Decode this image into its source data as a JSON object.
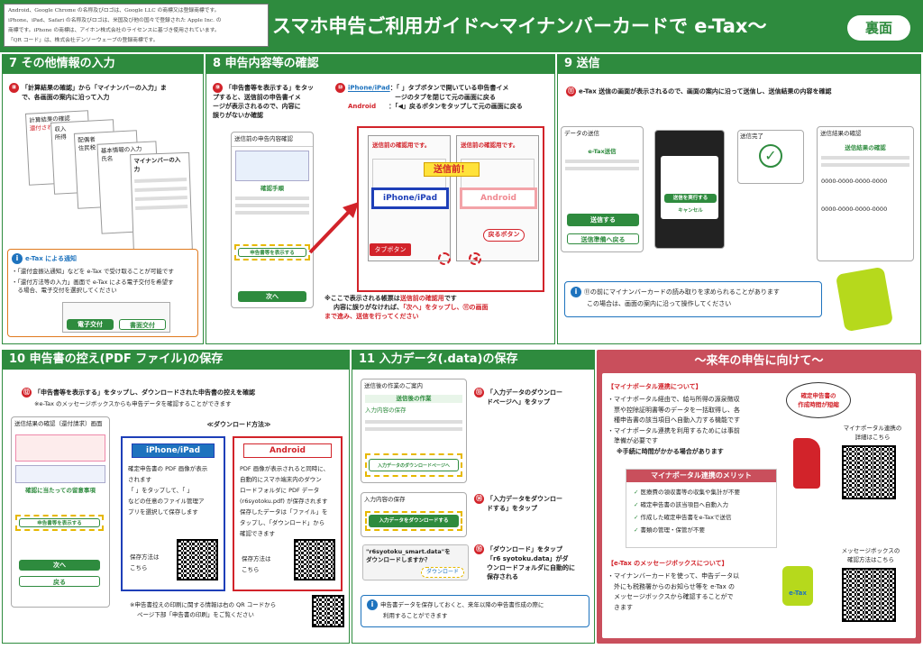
{
  "header": {
    "notice": [
      "Android、Google Chrome の名称及びロゴは、Google LLC の商標又は登録商標です。",
      "iPhone、iPad、Safari の名称及びロゴは、米国及び他の国々で登録された Apple Inc. の",
      "商標です。iPhone の商標は、アイホン株式会社のライセンスに基づき使用されています。",
      "「QR コード」は、株式会社デンソーウェーブの登録商標です。"
    ],
    "title": "スマホ申告ご利用ガイド～マイナンバーカードで e-Tax～",
    "badge": "裏面"
  },
  "s7": {
    "title": "7 その他情報の入力",
    "step": "⑧",
    "text1": "「計算結果の確認」から「マイナンバーの入力」ま",
    "text2": "で、各画面の案内に沿って入力",
    "screen_labels": [
      "計算結果の確認",
      "還付される金額",
      "収入",
      "所得",
      "配偶者",
      "住民税",
      "基本情報の入力",
      "氏名",
      "マイナンバーの入力"
    ],
    "info_title": "e-Tax による通知",
    "info1": "・「還付金振込通知」などを e-Tax で受け取ることが可能です",
    "info2": "・「還付方法等の入力」画面で e-Tax による電子交付を希望す",
    "info3": "　る場合、電子交付を選択してください",
    "mini_btn1": "電子交付",
    "mini_btn2": "書面交付"
  },
  "s8": {
    "title": "8 申告内容等の確認",
    "step9": "⑨",
    "t1": "「申告書等を表示する」をタッ",
    "t2": "プすると、送信前の申告書イメ",
    "t3": "ージが表示されるので、内容に",
    "t4": "誤りがないか確認",
    "step10": "⑩",
    "ios_label": "iPhone/iPad",
    "ios_text1": "：「 」タブボタンで開いている申告書イメ",
    "ios_text2": "ージのタブを閉じて元の画面に戻る",
    "android_label": "Android",
    "android_text": "：「◀」戻るボタンをタップして元の画面に戻る",
    "phone_title": "送信前の申告内容確認",
    "phone_section": "確認手順",
    "phone_btn": "申告書等を表示する",
    "phone_next": "次へ",
    "preview_banner": "送信前！",
    "preview_ios": "iPhone/iPad",
    "preview_android": "Android",
    "preview_stamp": "送信前の確認用です。",
    "tab_btn": "タブボタン",
    "back_btn": "戻るボタン",
    "note1": "※ここで表示される帳票は",
    "note1_red": "送信前の確認用",
    "note1_end": "です",
    "note2": "内容に誤りがなければ、",
    "note2_red": "「次へ」をタップし、⑪の画面",
    "note3_red": "まで進み、送信を行ってください"
  },
  "s9": {
    "title": "9 送信",
    "step": "⑪",
    "text": "e-Tax 送信の画面が表示されるので、画面の案内に沿って送信し、送信結果の内容を確認",
    "screen1_title": "データの送信",
    "screen1_head": "e-Tax送信",
    "screen1_btn": "送信する",
    "screen1_back": "送信準備へ戻る",
    "screen2_btn": "送信を実行する",
    "screen2_cancel": "キャンセル",
    "screen3_title": "送信完了",
    "screen4_title": "送信結果の確認",
    "screen4_head": "送信結果の確認",
    "screen4_num": "0000-0000-0000-0000",
    "info": "⑪の前にマイナンバーカードの読み取りを求められることがあります",
    "info2": "この場合は、画面の案内に沿って操作してください"
  },
  "s10": {
    "title": "10 申告書の控え(PDF ファイル)の保存",
    "step": "⑫",
    "text": "「申告書等を表示する」をタップし、ダウンロードされた申告書の控えを確認",
    "note": "※e-Tax のメッセージボックスからも申告データを確認することができます",
    "method_title": "≪ダウンロード方法≫",
    "ios_title": "iPhone/iPad",
    "ios_body": [
      "確定申告書の PDF 画像が表示",
      "されます",
      "「 」をタップして、「 」",
      "などの任意のファイル管理ア",
      "プリを選択して保存します"
    ],
    "ios_save": [
      "保存方法は",
      "こちら"
    ],
    "android_title": "Android",
    "android_body": [
      "PDF 画像が表示されると同時に、",
      "自動的にスマホ端末内のダウン",
      "ロードフォルダに PDF データ",
      "(r6syotoku.pdf) が保存されます",
      "保存したデータは「ファイル」を",
      "タップし、「ダウンロード」から",
      "確認できます"
    ],
    "android_save": [
      "保存方法は",
      "こちら"
    ],
    "print_note": [
      "※申告書控えの印刷に関する情報は右の QR コードから",
      "ページ下部「申告書の印刷」をご覧ください"
    ],
    "phone_title": "送信結果の確認（還付請求）画面",
    "phone_banner": "確認に当たっての留意事項",
    "phone_btn": "申告書等を表示する",
    "phone_next": "次へ",
    "phone_back": "戻る"
  },
  "s11": {
    "title": "11 入力データ(.data)の保存",
    "step13": "⑬",
    "t13a": "「入力データのダウンロー",
    "t13b": "ドページへ」をタップ",
    "step14": "⑭",
    "t14a": "「入力データをダウンロー",
    "t14b": "ドする」をタップ",
    "step15": "⑮",
    "t15a": "「ダウンロード」をタップ",
    "t15b": "「r6 syotoku.data」がダ",
    "t15c": "ウンロードフォルダに自動的に",
    "t15d": "保存される",
    "phone1_title": "送信後の作業のご案内",
    "phone1_head": "送信後の作業",
    "phone1_sub": "入力内容の保存",
    "phone1_btn": "入力データのダウンロードページへ",
    "phone2_title": "入力内容の保存",
    "phone2_btn": "入力データをダウンロードする",
    "dl_file": "\"r6syotoku_smart.data\"を",
    "dl_ask": "ダウンロードしますか？",
    "dl_btn": "ダウンロード",
    "info1": "申告書データを保存しておくと、来年以降の申告書作成の際に",
    "info2": "利用することができます"
  },
  "next": {
    "title": "～来年の申告に向けて～",
    "mp_title": "【マイナポータル連携について】",
    "mp_body": [
      "・マイナポータル経由で、給与所得の源泉徴収",
      "　票や控除証明書等のデータを一括取得し、各",
      "　種申告書の該当項目へ自動入力する機能です",
      "・マイナポータル連携を利用するためには事前",
      "　準備が必要です"
    ],
    "mp_note": "※手続に時間がかかる場合があります",
    "bubble": [
      "確定申告書の",
      "作成時間が短縮"
    ],
    "qr1_label": [
      "マイナポータル連携の",
      "詳細はこちら"
    ],
    "merit_title": "マイナポータル連携のメリット",
    "merits": [
      "医療費の領収書等の収集や集計が不要",
      "確定申告書の該当項目へ自動入力",
      "作成した確定申告書をe-Taxで送信",
      "書類の管理・保管が不要"
    ],
    "mb_title": "【e-Tax のメッセージボックスについて】",
    "mb_body": [
      "・マイナンバーカードを使って、申告データ以",
      "　外にも税務署からのお知らせ等を e-Tax の",
      "　メッセージボックスから確認することがで",
      "　きます"
    ],
    "qr2_label": [
      "メッセージボックスの",
      "確認方法はこちら"
    ],
    "mascot_label": "e-Tax"
  },
  "colors": {
    "green": "#2e8b3e",
    "red": "#d2232a",
    "blue": "#1e73be",
    "pink": "#c94f5c",
    "yellow": "#e6b800"
  }
}
